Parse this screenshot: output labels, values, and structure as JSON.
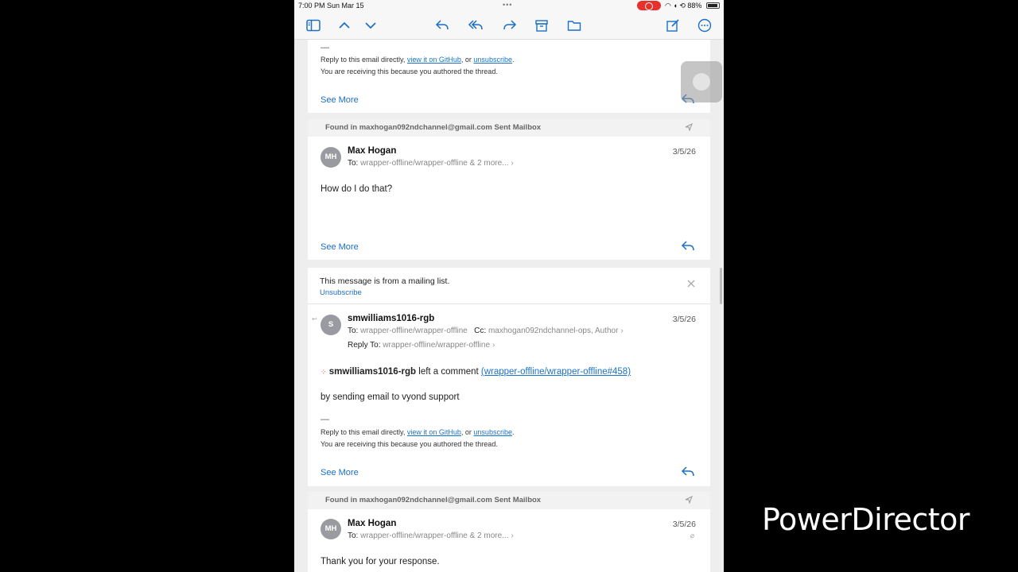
{
  "status_bar": {
    "time_date": "7:00 PM  Sun Mar 15",
    "multitask_dots": "•••",
    "battery": "88%"
  },
  "thread_top": {
    "reply_prefix": "Reply to this email directly, ",
    "view_link": "view it on GitHub",
    "or_text": ", or ",
    "unsubscribe_link": "unsubscribe",
    "period": ".",
    "receiving_note": "You are receiving this because you authored the thread.",
    "see_more": "See More"
  },
  "found_label_1": "Found in maxhogan092ndchannel@gmail.com Sent Mailbox",
  "message_1": {
    "avatar": "MH",
    "sender": "Max Hogan",
    "date": "3/5/26",
    "to_label": "To:",
    "to_value": "wrapper-offline/wrapper-offline & 2 more...",
    "body": "How do I do that?",
    "see_more": "See More"
  },
  "mailing_banner": {
    "message": "This message is from a mailing list.",
    "unsubscribe": "Unsubscribe"
  },
  "message_2": {
    "avatar": "S",
    "sender": "smwilliams1016-rgb",
    "date": "3/5/26",
    "to_label": "To:",
    "to_value": "wrapper-offline/wrapper-offline",
    "cc_label": "Cc:",
    "cc_value": "maxhogan092ndchannel-ops, Author",
    "reply_to_label": "Reply To:",
    "reply_to_value": "wrapper-offline/wrapper-offline",
    "comment_user": "smwilliams1016-rgb",
    "comment_action": " left a comment ",
    "comment_link": "(wrapper-offline/wrapper-offline#458)",
    "body": "by sending email to vyond support",
    "dash": "—",
    "reply_prefix": "Reply to this email directly, ",
    "view_link": "view it on GitHub",
    "or_text": ", or ",
    "unsubscribe_link": "unsubscribe",
    "period": ".",
    "receiving_note": "You are receiving this because you authored the thread.",
    "see_more": "See More"
  },
  "found_label_2": "Found in maxhogan092ndchannel@gmail.com Sent Mailbox",
  "message_3": {
    "avatar": "MH",
    "sender": "Max Hogan",
    "date": "3/5/26",
    "to_label": "To:",
    "to_value": "wrapper-offline/wrapper-offline & 2 more...",
    "body": "Thank you for your response."
  },
  "watermark": "PowerDirector",
  "colors": {
    "accent": "#1b6fc5",
    "record": "#e8312b"
  }
}
